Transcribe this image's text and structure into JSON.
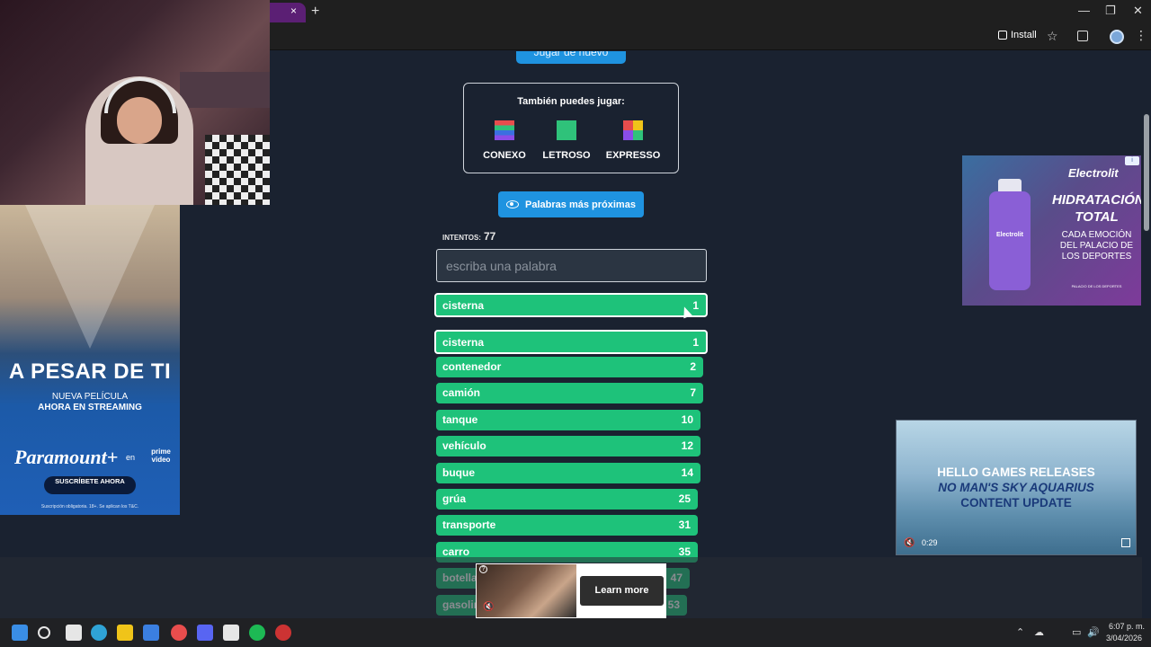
{
  "browser": {
    "tab_close": "×",
    "new_tab": "+",
    "install_label": "Install",
    "star": "☆",
    "menu": "⋮",
    "minimize": "—",
    "maximize": "❐",
    "close": "✕"
  },
  "game": {
    "play_again_label": "Jugar de nuevo",
    "also_play_title": "También puedes jugar:",
    "other_games": [
      {
        "name": "CONEXO",
        "colors": [
          "#e84d4d",
          "#2fc27a",
          "#3b6fe0",
          "#8a4de8"
        ]
      },
      {
        "name": "LETROSO",
        "colors": [
          "#2fc27a",
          "#2fc27a",
          "#2fc27a",
          "#2fc27a"
        ]
      },
      {
        "name": "EXPRESSO",
        "colors": [
          "#f0c419",
          "#2fc27a",
          "#8a4de8",
          "#e84d4d"
        ]
      }
    ],
    "closest_words_label": "Palabras más próximas",
    "attempts_label": "INTENTOS:",
    "attempts_value": "77",
    "input_placeholder": "escriba una palabra",
    "last_guess": {
      "word": "cisterna",
      "rank": "1",
      "fill": 1.0
    },
    "guesses": [
      {
        "word": "cisterna",
        "rank": "1",
        "fill": 1.0
      },
      {
        "word": "contenedor",
        "rank": "2",
        "fill": 0.99
      },
      {
        "word": "camión",
        "rank": "7",
        "fill": 0.99
      },
      {
        "word": "tanque",
        "rank": "10",
        "fill": 0.98
      },
      {
        "word": "vehículo",
        "rank": "12",
        "fill": 0.98
      },
      {
        "word": "buque",
        "rank": "14",
        "fill": 0.98
      },
      {
        "word": "grúa",
        "rank": "25",
        "fill": 0.97
      },
      {
        "word": "transporte",
        "rank": "31",
        "fill": 0.97
      },
      {
        "word": "carro",
        "rank": "35",
        "fill": 0.97
      },
      {
        "word": "botella",
        "rank": "47",
        "fill": 0.94
      },
      {
        "word": "gasolina",
        "rank": "53",
        "fill": 0.93
      }
    ]
  },
  "left_ad": {
    "title": "A PESAR DE TI",
    "subtitle1": "NUEVA PELÍCULA",
    "subtitle2": "AHORA EN STREAMING",
    "brand": "Paramount+",
    "en": "en",
    "prime": "prime video",
    "cta": "SUSCRÍBETE AHORA",
    "fine_print": "Suscripción obligatoria. 18+. Se aplican los T&C."
  },
  "right_ad": {
    "brand": "Electrolit",
    "headline": "HIDRATACIÓN TOTAL",
    "sub": "CADA EMOCIÓN DEL PALACIO DE LOS DEPORTES",
    "footer": "PALACIO DE LOS DEPORTES",
    "bottle_label": "Electrolit"
  },
  "video_ad": {
    "line1": "HELLO GAMES RELEASES",
    "line2": "NO MAN'S SKY AQUARIUS",
    "line3": "CONTENT UPDATE",
    "time": "0:29"
  },
  "bottom_ad": {
    "cta": "Learn more",
    "help": "?"
  },
  "taskbar": {
    "time": "6:07 p. m.",
    "date": "3/04/2026",
    "apps": [
      {
        "name": "windows-start",
        "color": "#3a8ee6"
      },
      {
        "name": "search",
        "color": "#e6e6e6"
      },
      {
        "name": "task-view",
        "color": "#e6e6e6"
      },
      {
        "name": "edge",
        "color": "#2fa3d6"
      },
      {
        "name": "file-explorer",
        "color": "#f0c419"
      },
      {
        "name": "store",
        "color": "#3b7fe0"
      },
      {
        "name": "chrome",
        "color": "#e84d4d"
      },
      {
        "name": "discord",
        "color": "#5865f2"
      },
      {
        "name": "obs",
        "color": "#e6e6e6"
      },
      {
        "name": "spotify",
        "color": "#1db954"
      },
      {
        "name": "app-red",
        "color": "#cc3333"
      }
    ]
  }
}
